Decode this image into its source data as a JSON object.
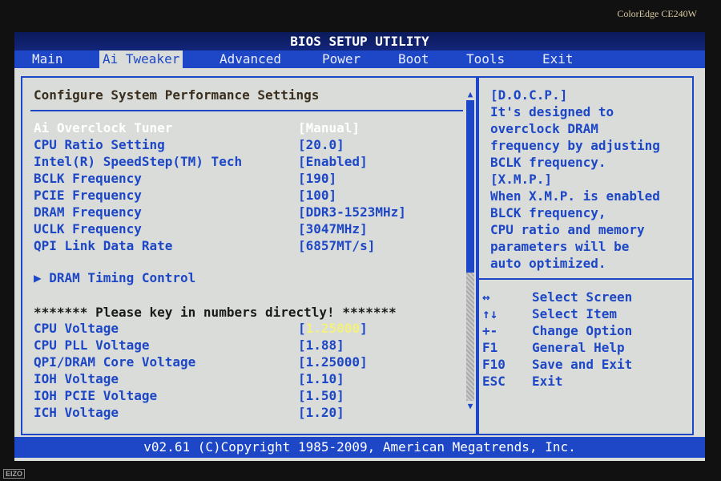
{
  "monitor": {
    "model": "ColorEdge CE240W",
    "brand": "EIZO"
  },
  "title": "BIOS SETUP UTILITY",
  "tabs": [
    "Main",
    "Ai Tweaker",
    "Advanced",
    "Power",
    "Boot",
    "Tools",
    "Exit"
  ],
  "active_tab": "Ai Tweaker",
  "panel_title": "Configure System Performance Settings",
  "settings": [
    {
      "label": "Ai Overclock Tuner",
      "value": "[Manual]"
    },
    {
      "label": "CPU Ratio Setting",
      "value": "[20.0]"
    },
    {
      "label": "Intel(R) SpeedStep(TM) Tech",
      "value": "[Enabled]"
    },
    {
      "label": "BCLK Frequency",
      "value": "[190]"
    },
    {
      "label": "PCIE Frequency",
      "value": "[100]"
    },
    {
      "label": "DRAM Frequency",
      "value": "[DDR3-1523MHz]"
    },
    {
      "label": "UCLK Frequency",
      "value": "[3047MHz]"
    },
    {
      "label": "QPI Link Data Rate",
      "value": "[6857MT/s]"
    }
  ],
  "submenu": "▶ DRAM Timing Control",
  "notice": "******* Please key in numbers directly! *******",
  "voltages": [
    {
      "label": "CPU Voltage",
      "value": "1.25000"
    },
    {
      "label": "CPU PLL Voltage",
      "value": "[1.88]"
    },
    {
      "label": "QPI/DRAM Core Voltage",
      "value": "[1.25000]"
    },
    {
      "label": "IOH Voltage",
      "value": "[1.10]"
    },
    {
      "label": "IOH PCIE Voltage",
      "value": "[1.50]"
    },
    {
      "label": "ICH Voltage",
      "value": "[1.20]"
    }
  ],
  "help_text": [
    "[D.O.C.P.]",
    "It's designed to",
    "overclock DRAM",
    "frequency by adjusting",
    "BCLK frequency.",
    "[X.M.P.]",
    "When X.M.P. is enabled",
    "BLCK frequency,",
    "CPU ratio and memory",
    "parameters will be",
    "auto optimized."
  ],
  "keys": [
    {
      "key": "↔",
      "desc": "Select Screen"
    },
    {
      "key": "↑↓",
      "desc": "Select Item"
    },
    {
      "key": "+-",
      "desc": "Change Option"
    },
    {
      "key": "F1",
      "desc": "General Help"
    },
    {
      "key": "F10",
      "desc": "Save and Exit"
    },
    {
      "key": "ESC",
      "desc": "Exit"
    }
  ],
  "footer": "v02.61 (C)Copyright 1985-2009, American Megatrends, Inc.",
  "colors": {
    "accent": "#1d47c6",
    "background": "#d9dcd8"
  }
}
